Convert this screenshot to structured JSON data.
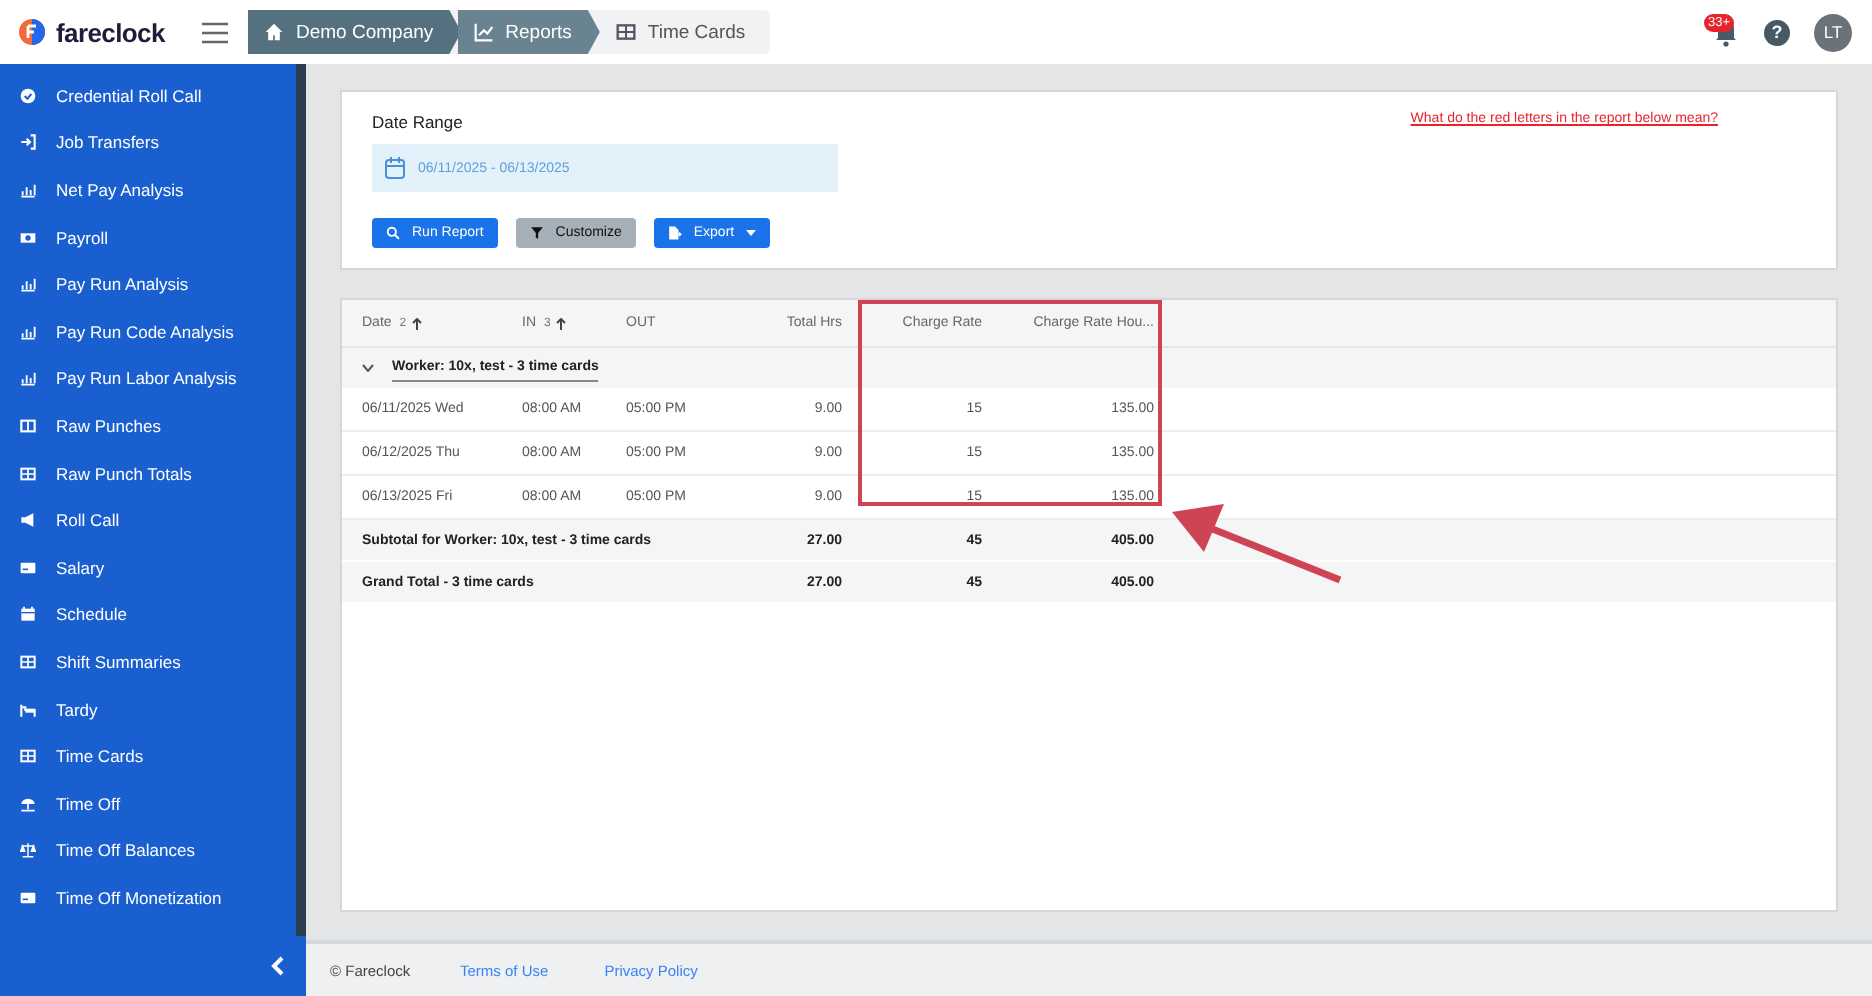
{
  "header": {
    "logo_text": "fareclock",
    "breadcrumbs": [
      {
        "label": "Demo Company",
        "kind": "home",
        "selected": false
      },
      {
        "label": "Reports",
        "kind": "chart",
        "selected": false
      },
      {
        "label": "Time Cards",
        "kind": "table",
        "selected": true
      }
    ],
    "notification_badge": "33+",
    "help": "?",
    "avatar": "LT"
  },
  "sidebar": {
    "items": [
      {
        "label": "Credential Roll Call"
      },
      {
        "label": "Job Transfers"
      },
      {
        "label": "Net Pay Analysis"
      },
      {
        "label": "Payroll"
      },
      {
        "label": "Pay Run Analysis"
      },
      {
        "label": "Pay Run Code Analysis"
      },
      {
        "label": "Pay Run Labor Analysis"
      },
      {
        "label": "Raw Punches"
      },
      {
        "label": "Raw Punch Totals"
      },
      {
        "label": "Roll Call"
      },
      {
        "label": "Salary"
      },
      {
        "label": "Schedule"
      },
      {
        "label": "Shift Summaries"
      },
      {
        "label": "Tardy"
      },
      {
        "label": "Time Cards"
      },
      {
        "label": "Time Off"
      },
      {
        "label": "Time Off Balances"
      },
      {
        "label": "Time Off Monetization"
      }
    ]
  },
  "filters": {
    "date_range_label": "Date Range",
    "date_range": "06/11/2025 - 06/13/2025",
    "help_link": "What do the red letters in the report below mean?",
    "buttons": [
      {
        "label": "Run Report",
        "kind": "search"
      },
      {
        "label": "Customize",
        "kind": "filter"
      },
      {
        "label": "Export",
        "kind": "export"
      }
    ]
  },
  "table": {
    "columns": [
      {
        "label": "Date",
        "sort": "2"
      },
      {
        "label": "IN",
        "sort": "3"
      },
      {
        "label": "OUT"
      },
      {
        "label": "Total Hrs"
      },
      {
        "label": "Charge Rate"
      },
      {
        "label": "Charge Rate Hou..."
      }
    ],
    "group": {
      "label": "Worker: 10x, test - 3 time cards",
      "expanded": true
    },
    "rows": [
      [
        "06/11/2025 Wed",
        "08:00 AM",
        "05:00 PM",
        "9.00",
        "15",
        "135.00"
      ],
      [
        "06/12/2025 Thu",
        "08:00 AM",
        "05:00 PM",
        "9.00",
        "15",
        "135.00"
      ],
      [
        "06/13/2025 Fri",
        "08:00 AM",
        "05:00 PM",
        "9.00",
        "15",
        "135.00"
      ]
    ],
    "totals": [
      {
        "label": "Subtotal for Worker: 10x, test - 3 time cards",
        "values": [
          "27.00",
          "45",
          "405.00"
        ]
      },
      {
        "label": "Grand Total - 3 time cards",
        "values": [
          "27.00",
          "45",
          "405.00"
        ]
      }
    ]
  },
  "footer": {
    "copyright": "© Fareclock",
    "links": [
      "Terms of Use",
      "Privacy Policy"
    ]
  }
}
